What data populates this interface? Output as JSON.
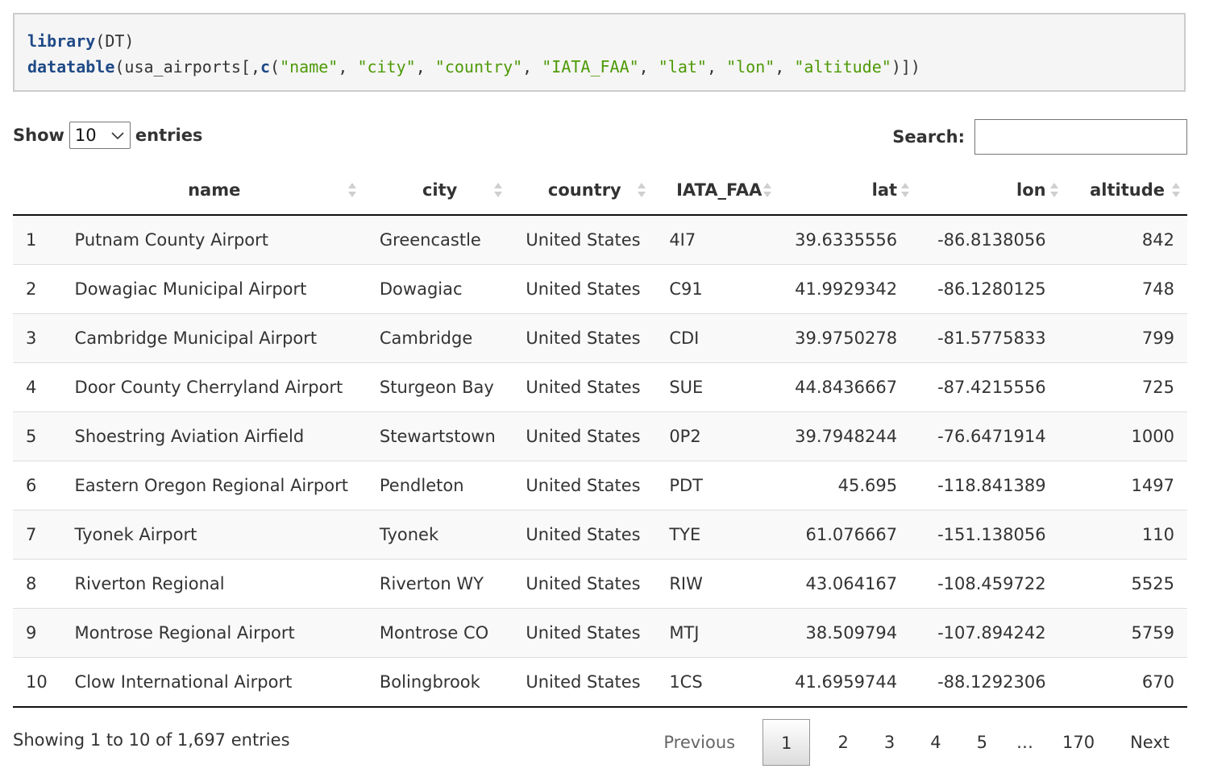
{
  "code": {
    "line1": {
      "fn": "library",
      "rest": "(DT)"
    },
    "line2": {
      "fn": "datatable",
      "mid": "(usa_airports[,",
      "c": "c",
      "open": "(",
      "args": [
        "\"name\"",
        "\"city\"",
        "\"country\"",
        "\"IATA_FAA\"",
        "\"lat\"",
        "\"lon\"",
        "\"altitude\""
      ],
      "sep": ", ",
      "close": ")])"
    }
  },
  "controls": {
    "show_label": "Show",
    "length_value": "10",
    "entries_label": "entries",
    "search_label": "Search:",
    "search_value": ""
  },
  "table": {
    "columns": [
      "",
      "name",
      "city",
      "country",
      "IATA_FAA",
      "lat",
      "lon",
      "altitude"
    ],
    "rows": [
      [
        "1",
        "Putnam County Airport",
        "Greencastle",
        "United States",
        "4I7",
        "39.6335556",
        "-86.8138056",
        "842"
      ],
      [
        "2",
        "Dowagiac Municipal Airport",
        "Dowagiac",
        "United States",
        "C91",
        "41.9929342",
        "-86.1280125",
        "748"
      ],
      [
        "3",
        "Cambridge Municipal Airport",
        "Cambridge",
        "United States",
        "CDI",
        "39.9750278",
        "-81.5775833",
        "799"
      ],
      [
        "4",
        "Door County Cherryland Airport",
        "Sturgeon Bay",
        "United States",
        "SUE",
        "44.8436667",
        "-87.4215556",
        "725"
      ],
      [
        "5",
        "Shoestring Aviation Airfield",
        "Stewartstown",
        "United States",
        "0P2",
        "39.7948244",
        "-76.6471914",
        "1000"
      ],
      [
        "6",
        "Eastern Oregon Regional Airport",
        "Pendleton",
        "United States",
        "PDT",
        "45.695",
        "-118.841389",
        "1497"
      ],
      [
        "7",
        "Tyonek Airport",
        "Tyonek",
        "United States",
        "TYE",
        "61.076667",
        "-151.138056",
        "110"
      ],
      [
        "8",
        "Riverton Regional",
        "Riverton WY",
        "United States",
        "RIW",
        "43.064167",
        "-108.459722",
        "5525"
      ],
      [
        "9",
        "Montrose Regional Airport",
        "Montrose CO",
        "United States",
        "MTJ",
        "38.509794",
        "-107.894242",
        "5759"
      ],
      [
        "10",
        "Clow International Airport",
        "Bolingbrook",
        "United States",
        "1CS",
        "41.6959744",
        "-88.1292306",
        "670"
      ]
    ]
  },
  "footer": {
    "info": "Showing 1 to 10 of 1,697 entries",
    "previous": "Previous",
    "pages": [
      "1",
      "2",
      "3",
      "4",
      "5"
    ],
    "ellipsis": "…",
    "last_page": "170",
    "next": "Next",
    "current_page": "1"
  }
}
